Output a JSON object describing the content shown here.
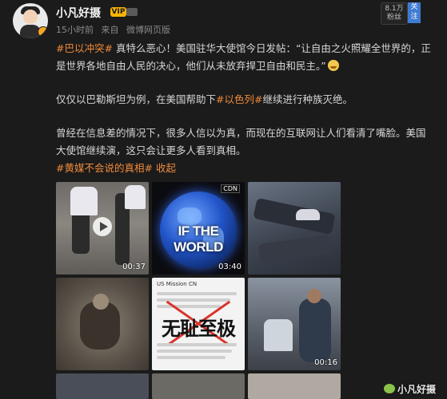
{
  "user": {
    "name": "小凡好摄",
    "vip_label": "VIP"
  },
  "meta": {
    "time": "15小时前",
    "from": "来自",
    "source": "微博网页版"
  },
  "fans": {
    "count": "8.1万",
    "label": "粉丝"
  },
  "follow_label": "关注",
  "post": {
    "p1_tag": "#巴以冲突#",
    "p1_text": "真特么恶心！美国驻华大使馆今日发帖：“让自由之火照耀全世界的，正是世界各地自由人民的决心，他们从未放弃捍卫自由和民主。”",
    "p2_a": "仅仅以巴勒斯坦为例，在美国帮助下",
    "p2_tag": "#以色列#",
    "p2_b": "继续进行种族灭绝。",
    "p3_text": "曾经在信息差的情况下，很多人信以为真，而现在的互联网让人们看清了嘴脸。美国大使馆继续演，这只会让更多人看到真相。",
    "p3_tag": "#黄媒不会说的真相#",
    "collapse": "收起"
  },
  "media": {
    "t1_duration": "00:37",
    "t2_label": "IF THE WORLD",
    "t2_badge": "CDN",
    "t2_duration": "03:40",
    "t5_header": "US Mission CN",
    "t5_big": "无耻至极",
    "t6_duration": "00:16"
  },
  "watermark": "小凡好摄"
}
